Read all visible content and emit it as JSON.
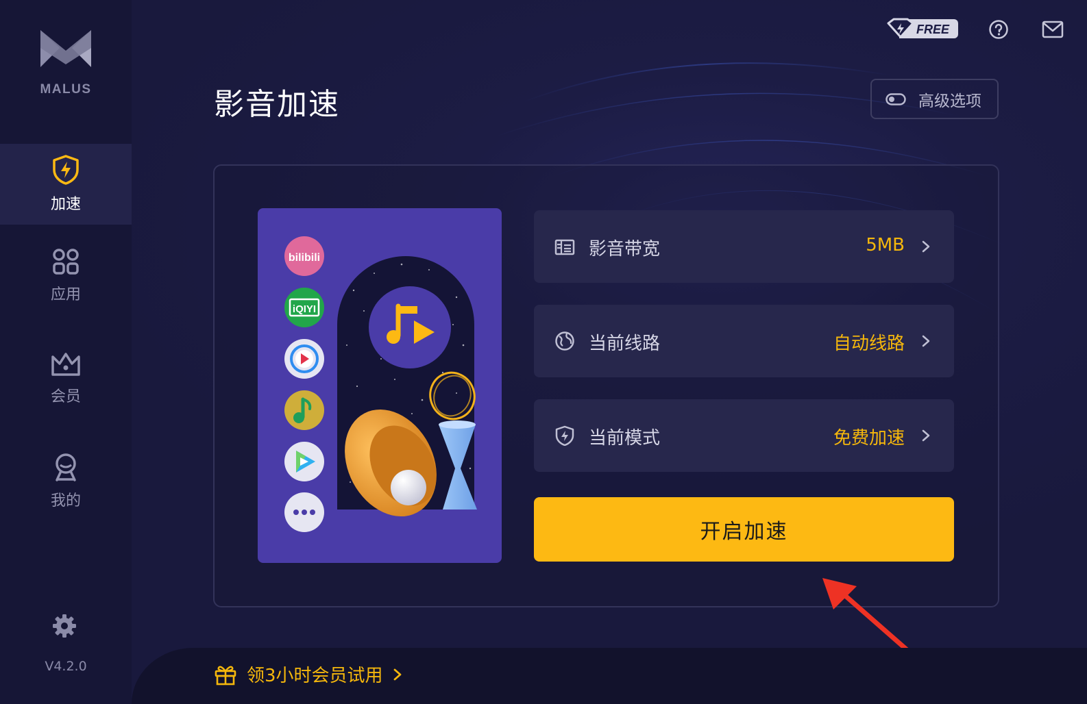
{
  "brand": {
    "name": "MALUS"
  },
  "sidebar": {
    "items": [
      {
        "label": "加速",
        "icon": "shield-bolt-icon",
        "active": true
      },
      {
        "label": "应用",
        "icon": "apps-grid-icon",
        "active": false
      },
      {
        "label": "会员",
        "icon": "crown-icon",
        "active": false
      },
      {
        "label": "我的",
        "icon": "user-icon",
        "active": false
      }
    ],
    "version": "V4.2.0"
  },
  "topbar": {
    "badge": "FREE"
  },
  "page": {
    "title": "影音加速",
    "advanced_label": "高级选项"
  },
  "settings": [
    {
      "label": "影音带宽",
      "value": "5MB",
      "icon": "bandwidth-icon"
    },
    {
      "label": "当前线路",
      "value": "自动线路",
      "icon": "globe-icon"
    },
    {
      "label": "当前模式",
      "value": "免费加速",
      "icon": "shield-bolt-icon"
    }
  ],
  "start_button": {
    "label": "开启加速"
  },
  "illustration": {
    "apps": [
      "bilibili",
      "iQIYI",
      "Tencent Video",
      "QQ Music",
      "Youku",
      "more"
    ],
    "bilibili_logo_text": "bilibili",
    "iqiyi_logo_text": "iQIYI"
  },
  "promo": {
    "label": "领3小时会员试用"
  },
  "colors": {
    "accent": "#fdb913",
    "value": "#f5b70c",
    "background": "#1c1c44",
    "sidebar": "#161636"
  }
}
